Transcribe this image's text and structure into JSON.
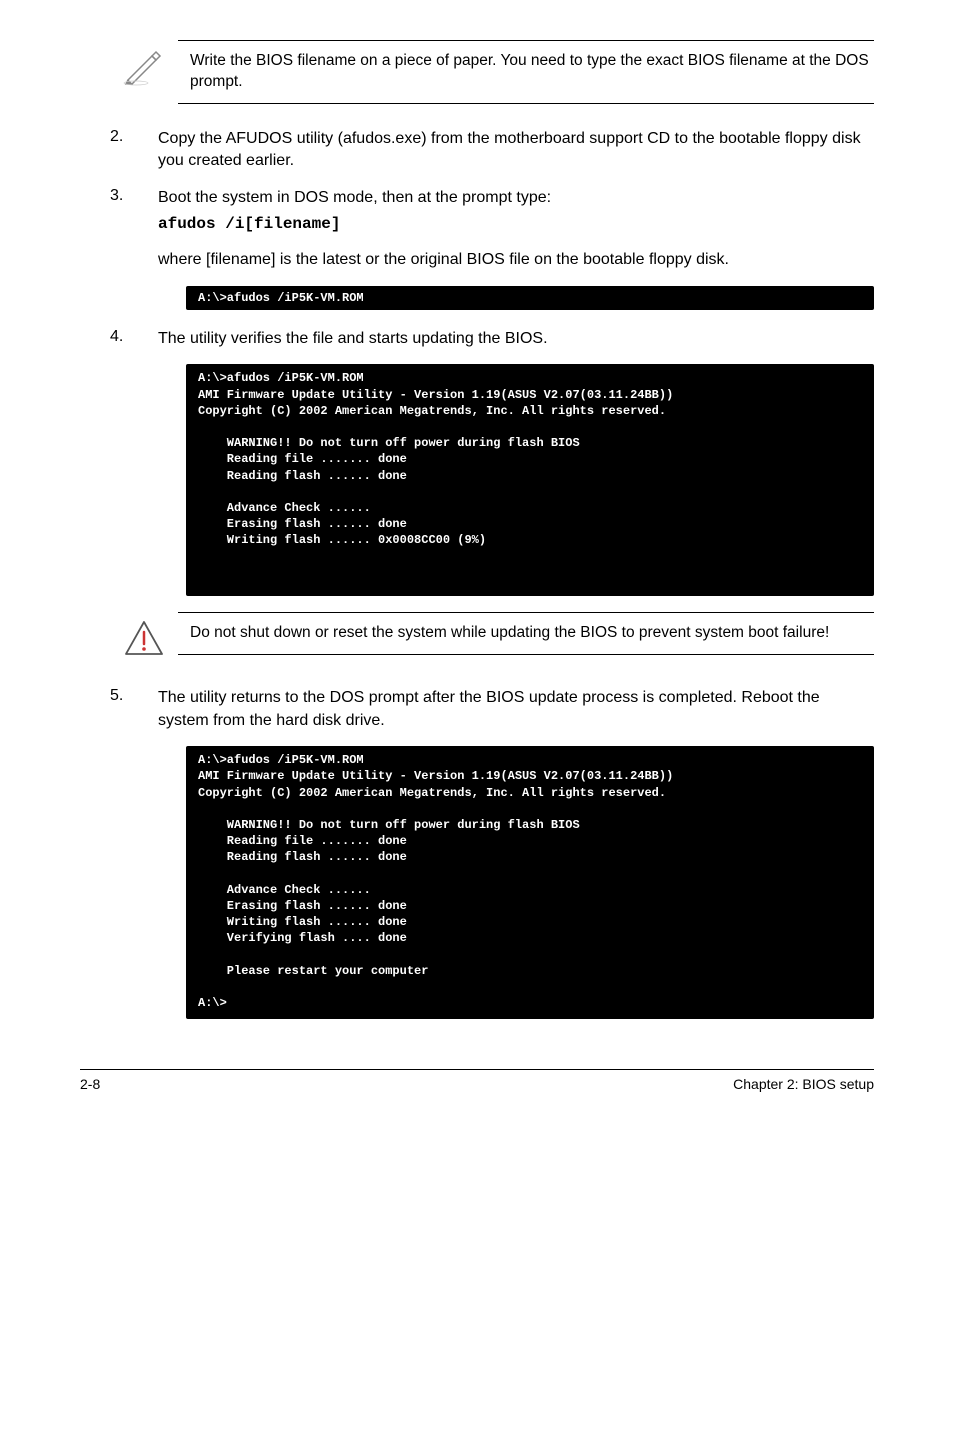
{
  "note1": "Write the BIOS filename on a piece of paper. You need to type the exact BIOS filename at the DOS prompt.",
  "steps": {
    "s2": {
      "num": "2.",
      "text": "Copy the AFUDOS utility (afudos.exe) from the motherboard support CD to the bootable floppy disk you created earlier."
    },
    "s3": {
      "num": "3.",
      "text": "Boot the system in DOS mode, then at the prompt type:",
      "cmd": "afudos /i[filename]",
      "sub": "where [filename] is the latest or the original BIOS file on the bootable floppy disk."
    },
    "s4": {
      "num": "4.",
      "text": "The utility verifies the file and starts updating the BIOS."
    },
    "s5": {
      "num": "5.",
      "text": "The utility returns to the DOS prompt after the BIOS update process is completed. Reboot the system from the hard disk drive."
    }
  },
  "term1": "A:\\>afudos /iP5K-VM.ROM",
  "term2": "A:\\>afudos /iP5K-VM.ROM\nAMI Firmware Update Utility - Version 1.19(ASUS V2.07(03.11.24BB))\nCopyright (C) 2002 American Megatrends, Inc. All rights reserved.\n\n    WARNING!! Do not turn off power during flash BIOS\n    Reading file ....... done\n    Reading flash ...... done\n\n    Advance Check ......\n    Erasing flash ...... done\n    Writing flash ...... 0x0008CC00 (9%)",
  "warn": "Do not shut down or reset the system while updating the BIOS to prevent system boot failure!",
  "term3": "A:\\>afudos /iP5K-VM.ROM\nAMI Firmware Update Utility - Version 1.19(ASUS V2.07(03.11.24BB))\nCopyright (C) 2002 American Megatrends, Inc. All rights reserved.\n\n    WARNING!! Do not turn off power during flash BIOS\n    Reading file ....... done\n    Reading flash ...... done\n\n    Advance Check ......\n    Erasing flash ...... done\n    Writing flash ...... done\n    Verifying flash .... done\n\n    Please restart your computer\n\nA:\\>",
  "footer": {
    "left": "2-8",
    "right": "Chapter 2: BIOS setup"
  }
}
